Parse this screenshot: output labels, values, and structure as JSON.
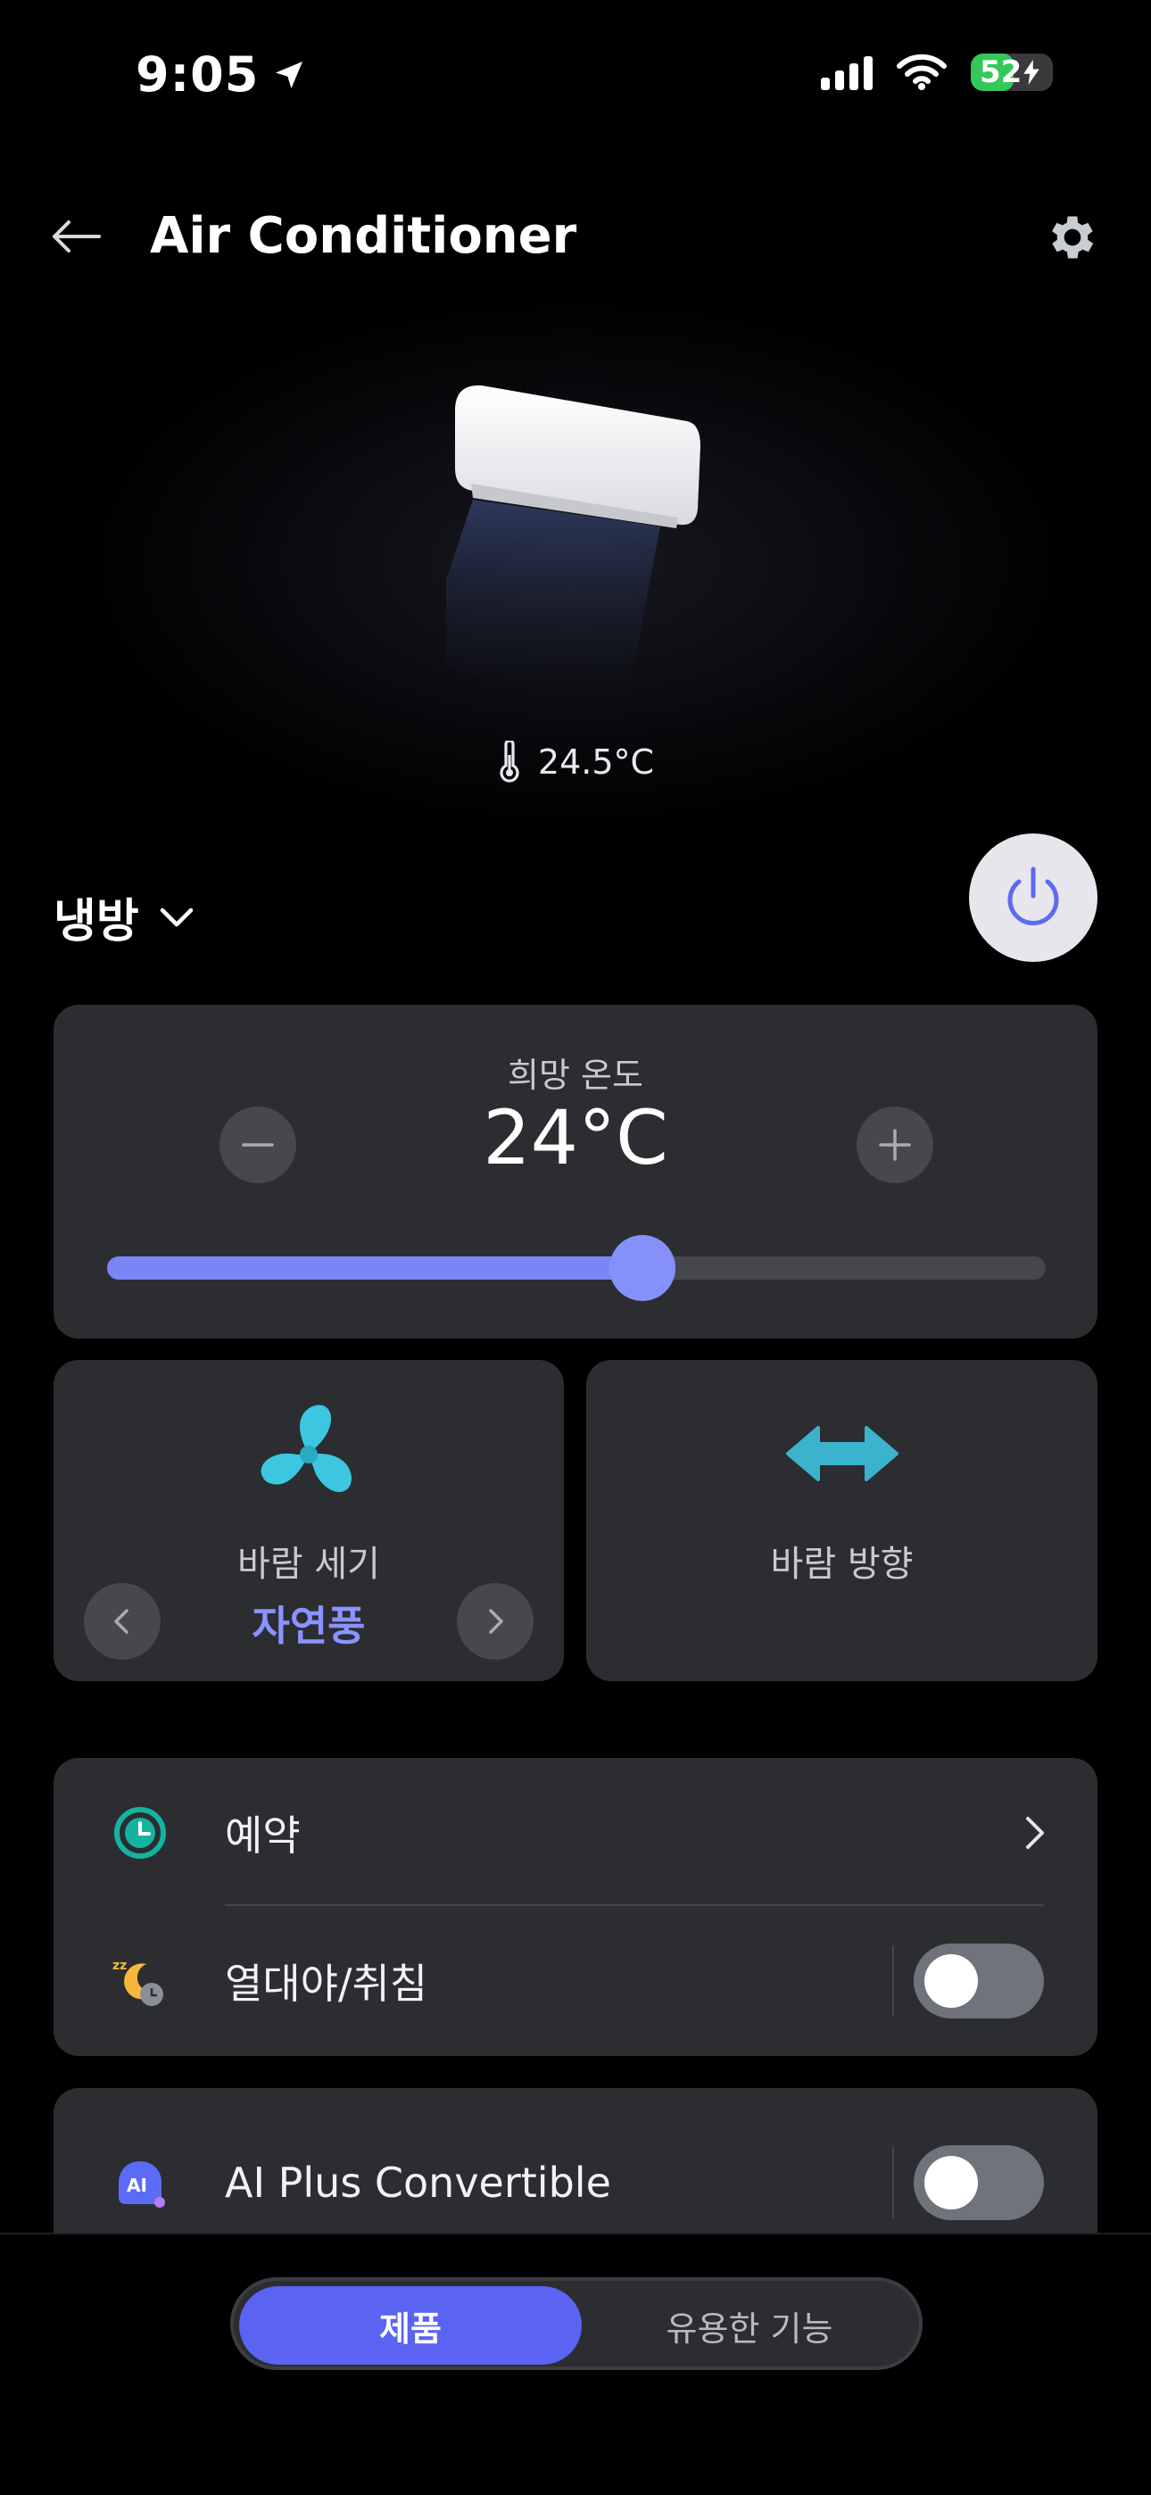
{
  "status_bar": {
    "time": "9:05",
    "battery": "52"
  },
  "header": {
    "title": "Air Conditioner"
  },
  "hero": {
    "room_temperature": "24.5°C"
  },
  "mode": {
    "label": "냉방"
  },
  "temperature": {
    "label": "희망 온도",
    "value": "24°C",
    "slider_fraction": 0.57
  },
  "fan_speed": {
    "label": "바람 세기",
    "value": "자연풍"
  },
  "wind_direction": {
    "label": "바람 방향"
  },
  "list": {
    "reservation_label": "예약",
    "sleep_label": "열대야/취침",
    "sleep_toggle_on": false,
    "ai_label": "AI Plus Convertible",
    "ai_toggle_on": false
  },
  "bottom_tabs": {
    "product": "제품",
    "features": "유용한 기능"
  },
  "colors": {
    "accent": "#7b86f6",
    "fan_icon": "#3cc6e0",
    "card_bg": "#2b2d31",
    "tab_active": "#5a63f2"
  }
}
